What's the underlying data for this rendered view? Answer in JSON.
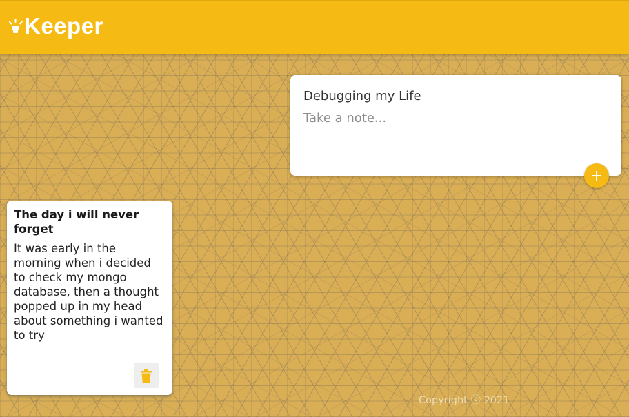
{
  "header": {
    "brand": "Keeper",
    "brand_icon": "lightbulb-icon"
  },
  "create_note": {
    "title_value": "Debugging my Life",
    "content_placeholder": "Take a note...",
    "add_icon": "plus-icon"
  },
  "notes": [
    {
      "title": "The day i will never forget",
      "content": "It was early in the morning when i decided to check my mongo database, then a thought popped up in my head about something i wanted to try",
      "delete_icon": "trash-icon"
    }
  ],
  "footer": {
    "copyright": "Copyright ⓒ 2021"
  },
  "colors": {
    "accent": "#f5ba13",
    "background": "#d9ae55",
    "card": "#ffffff"
  }
}
